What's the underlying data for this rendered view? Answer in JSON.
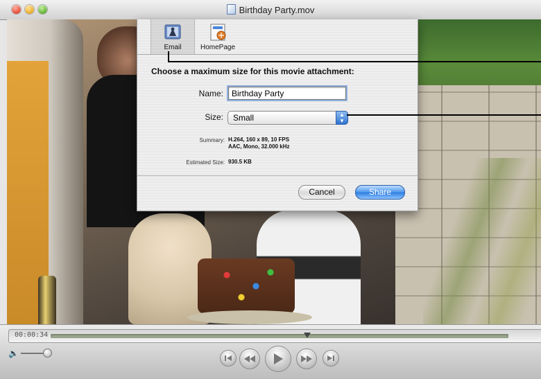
{
  "window": {
    "title": "Birthday Party.mov"
  },
  "sheet": {
    "toolbar": [
      {
        "label": "Email",
        "selected": true,
        "icon": "email-icon"
      },
      {
        "label": "HomePage",
        "selected": false,
        "icon": "homepage-icon"
      }
    ],
    "prompt": "Choose a maximum size for this movie attachment:",
    "name_label": "Name:",
    "name_value": "Birthday Party",
    "size_label": "Size:",
    "size_value": "Small",
    "summary_label": "Summary:",
    "summary_line1": "H.264, 160 x 89, 10 FPS",
    "summary_line2": "AAC, Mono, 32.000 kHz",
    "estimated_label": "Estimated Size:",
    "estimated_value": "930.5 KB",
    "cancel_label": "Cancel",
    "share_label": "Share"
  },
  "controller": {
    "time": "00:00:34",
    "playhead_fraction": 0.56,
    "volume_fraction": 1.0,
    "buttons": [
      "go-to-start-icon",
      "rewind-icon",
      "play-icon",
      "fast-forward-icon",
      "go-to-end-icon"
    ]
  },
  "colors": {
    "accent_blue": "#2e7de0",
    "selected_tool_bg": "#d8d8d8"
  }
}
